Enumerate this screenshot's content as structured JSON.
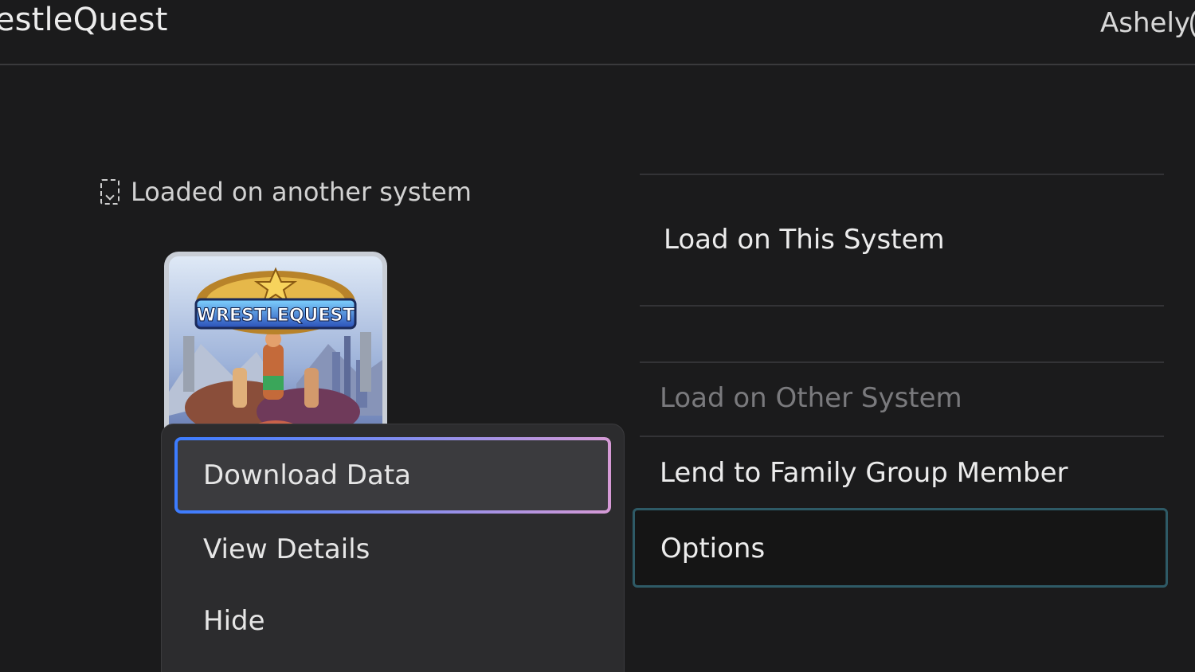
{
  "header": {
    "game_title": "restleQuest",
    "user_name": "Ashely"
  },
  "status": {
    "text": "Loaded on another system",
    "icon": "dashed-download-icon"
  },
  "artwork": {
    "logo_text": "WRESTLEQUEST"
  },
  "context_menu": {
    "items": [
      {
        "label": "Download Data",
        "focused": true
      },
      {
        "label": "View Details",
        "focused": false
      },
      {
        "label": "Hide",
        "focused": false
      }
    ]
  },
  "actions": {
    "load_this": "Load on This System",
    "load_other": "Load on Other System",
    "lend": "Lend to Family Group Member",
    "options": "Options"
  },
  "colors": {
    "background": "#1b1b1c",
    "menu_background": "#2c2c2e",
    "focus_gradient_start": "#3c7cff",
    "focus_gradient_end": "#d69ad6",
    "options_border": "#2e5a66"
  }
}
